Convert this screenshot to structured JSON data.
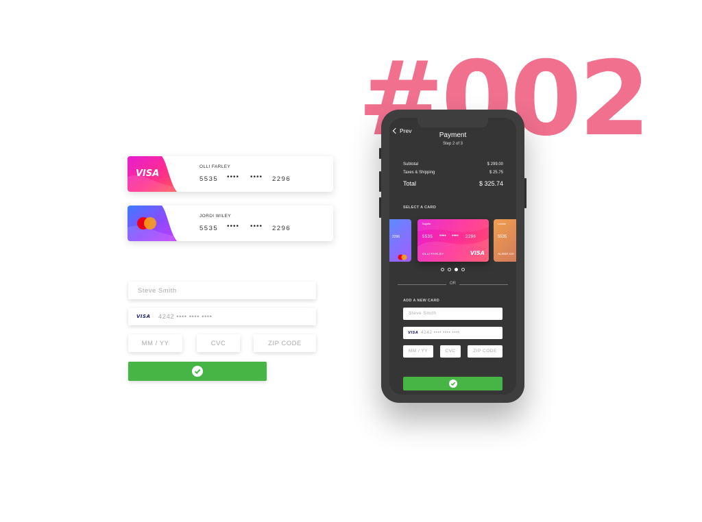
{
  "headline": "#002",
  "saved_cards": [
    {
      "brand": "VISA",
      "holder": "OLLI FARLEY",
      "first": "5535",
      "dots1": "••••",
      "dots2": "••••",
      "last": "2296"
    },
    {
      "brand": "mastercard",
      "holder": "JORDI WILEY",
      "first": "5535",
      "dots1": "••••",
      "dots2": "••••",
      "last": "2296"
    }
  ],
  "form": {
    "name_placeholder": "Steve Smith",
    "card_brand": "VISA",
    "card_number_placeholder": "4242  ••••  ••••  ••••",
    "expiry_placeholder": "MM / YY",
    "cvc_placeholder": "CVC",
    "zip_placeholder": "ZIP CODE"
  },
  "phone": {
    "back_label": "Prev",
    "title": "Payment",
    "step": "Step 2 of 3",
    "summary": {
      "subtotal_label": "Subtotal",
      "subtotal_value": "$ 299.00",
      "taxes_label": "Taxes & Shipping",
      "taxes_value": "$ 25.75",
      "total_label": "Total",
      "total_value": "$ 325.74"
    },
    "select_card_label": "SELECT A CARD",
    "carousel": {
      "left_card_last": "2296",
      "main_card_bank": "Bajaifa",
      "main_card_first": "5535",
      "main_card_dots1": "••••",
      "main_card_dots2": "••••",
      "main_card_last": "2296",
      "main_card_holder": "OLLI FARLEY",
      "main_card_brand": "VISA",
      "right_card_bank": "Lorium",
      "right_card_first": "5535",
      "right_card_holder": "ALISSA CO",
      "pager_active": 3,
      "pager_total": 4
    },
    "or_label": "OR",
    "add_card_label": "ADD A NEW CARD",
    "form": {
      "name_placeholder": "Steve Smith",
      "card_brand": "VISA",
      "card_number_placeholder": "4242  ••••  ••••  ••••",
      "expiry_placeholder": "MM / YY",
      "cvc_placeholder": "CVC",
      "zip_placeholder": "ZIP CODE"
    }
  },
  "colors": {
    "headline": "#f0708e",
    "submit": "#47b546",
    "phone_body": "#3e3e3e",
    "screen": "#353535"
  }
}
